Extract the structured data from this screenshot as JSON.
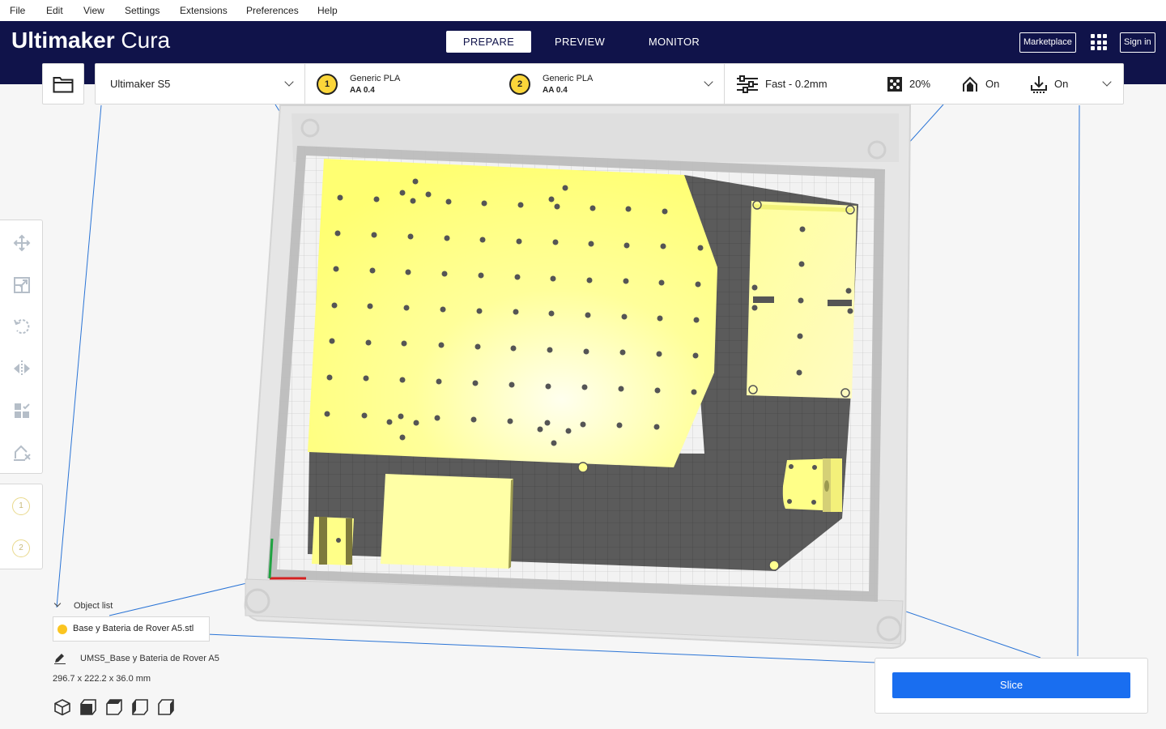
{
  "menu": {
    "file": "File",
    "edit": "Edit",
    "view": "View",
    "settings": "Settings",
    "extensions": "Extensions",
    "preferences": "Preferences",
    "help": "Help"
  },
  "header": {
    "logo_bold": "Ultimaker",
    "logo_light": "Cura",
    "tabs": [
      {
        "label": "PREPARE",
        "active": true
      },
      {
        "label": "PREVIEW",
        "active": false
      },
      {
        "label": "MONITOR",
        "active": false
      }
    ],
    "marketplace": "Marketplace",
    "sign_in": "Sign in",
    "apps_icon": "apps-grid-icon"
  },
  "print_setup": {
    "machine": "Ultimaker S5",
    "extruders": [
      {
        "number": "1",
        "material": "Generic PLA",
        "core": "AA 0.4",
        "color": "#fbd63a"
      },
      {
        "number": "2",
        "material": "Generic PLA",
        "core": "AA 0.4",
        "color": "#fbd63a"
      }
    ],
    "profile": "Fast - 0.2mm",
    "infill": "20%",
    "support": "On",
    "adhesion": "On"
  },
  "tools": [
    "move-icon",
    "scale-icon",
    "rotate-icon",
    "mirror-icon",
    "per-model-settings-icon",
    "support-blocker-icon"
  ],
  "tool_extruders": [
    "1",
    "2"
  ],
  "object_list": {
    "toggle_label": "Object list",
    "items": [
      {
        "name": "Base y Bateria de Rover A5.stl",
        "color": "#fbc521"
      }
    ]
  },
  "job": {
    "name": "UMS5_Base y Bateria de Rover A5",
    "dimensions": "296.7 x 222.2 x 36.0 mm"
  },
  "view_buttons": [
    "view-3d-icon",
    "view-front-icon",
    "view-top-icon",
    "view-left-icon",
    "view-right-icon"
  ],
  "slice": {
    "label": "Slice"
  },
  "colors": {
    "header_bg": "#10134a",
    "accent_blue": "#196ef0",
    "model_yellow": "#ffff7a",
    "disallowed_gray": "#5c5c5c"
  }
}
